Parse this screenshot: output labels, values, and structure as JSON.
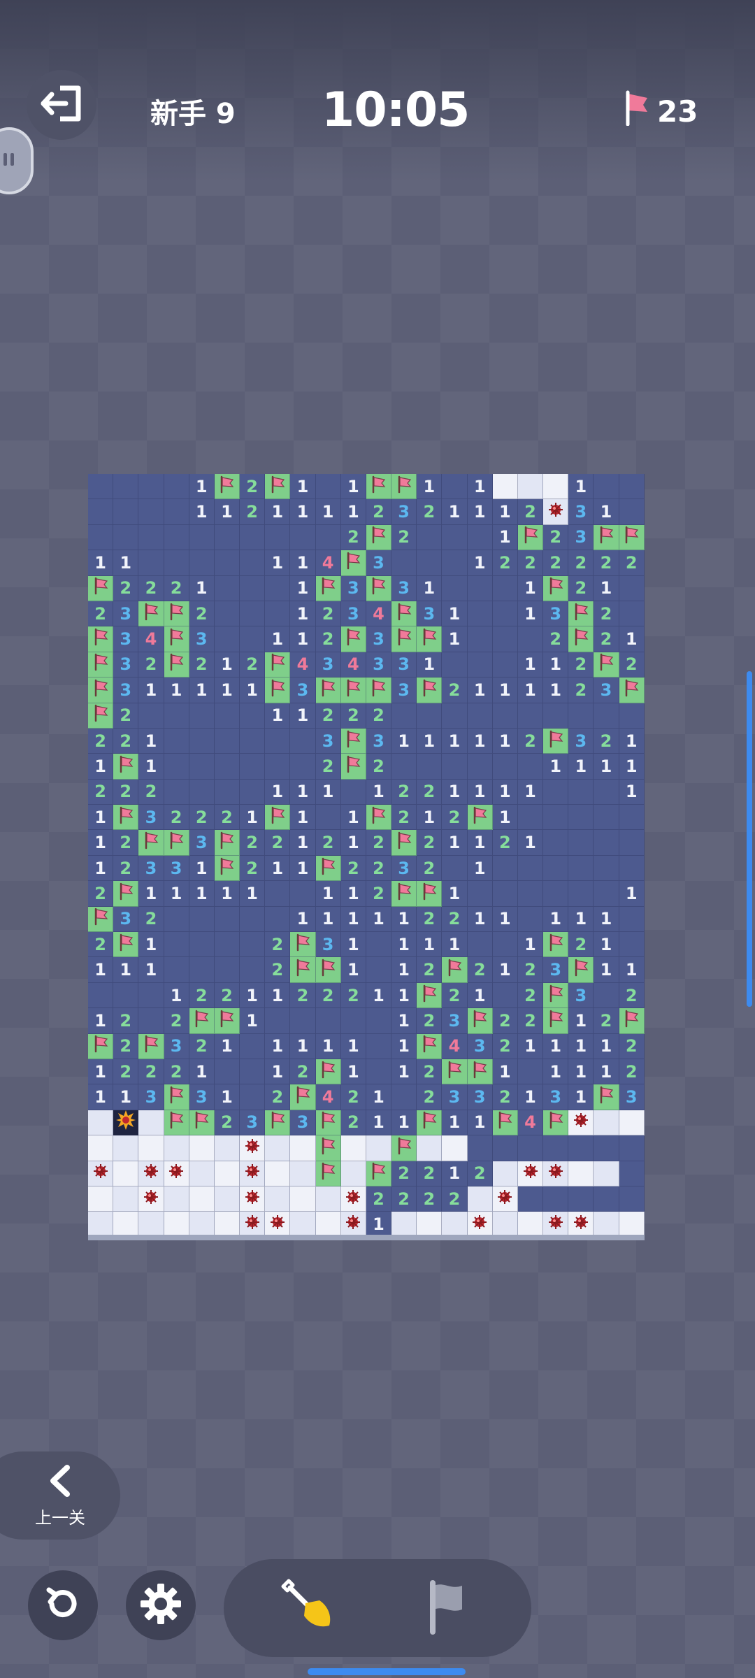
{
  "header": {
    "level": "新手 9",
    "timer": "10:05",
    "flags_remaining": "23"
  },
  "footer": {
    "prev_label": "上一关"
  },
  "tools": {
    "active": "dig"
  },
  "colors": {
    "board": "#4d5a8f",
    "flag_cell": "#7fcf8a",
    "hidden_light": "#f0f2f9",
    "hidden_dark": "#e2e6f4",
    "n1": "#f2f4fb",
    "n2": "#86dd9b",
    "n3": "#5cb8f0",
    "n4": "#f07a9a"
  },
  "board": {
    "cols": 22,
    "rows": [
      "....1F2F1.1FF1.1HHH1..",
      "....11211112321112M31.",
      "..........2F2...1F23FF21",
      "11.....114F3...1222222F",
      "F2221...1F3F31...1F21.11",
      "23FF2...1234F31..13F2..11",
      "F34F3..112F3FF1...2F212F",
      "F32F212F434331...112F2F2",
      "F311111F3FFF3F2111123F21",
      "F2.....11222",
      "221......3F3111112F3211",
      "1F1......2F2......11111F1",
      "222....111.1221111...111",
      "1F32221F1.1F212F1.......",
      "12FF3F221212F21121.....",
      "12331F211F2232.1......",
      "2F11111..112FF1......111",
      "F32.....111112211.111.1F1",
      "2F1....2F31.111..1F21.111",
      "111....2FF1.12F2123F112211",
      "...1221122211F21.2F3.2F1",
      "12.2FF1.....123F22F12F42",
      "F2F321.1111.1F43211112F",
      "12221..12F1.12FF1.111222",
      "113F31.2F421.2332131F32F",
      "HXHFF23F3F211F11F4FMHH",
      "HHHHHHMHHFHHFHH",
      "MHMMHHMHHFHF2212HMMHH",
      "HHMHHHMHHHM2222HM",
      "HHHHHHMMHHM1HHHMHHMMHH"
    ]
  }
}
